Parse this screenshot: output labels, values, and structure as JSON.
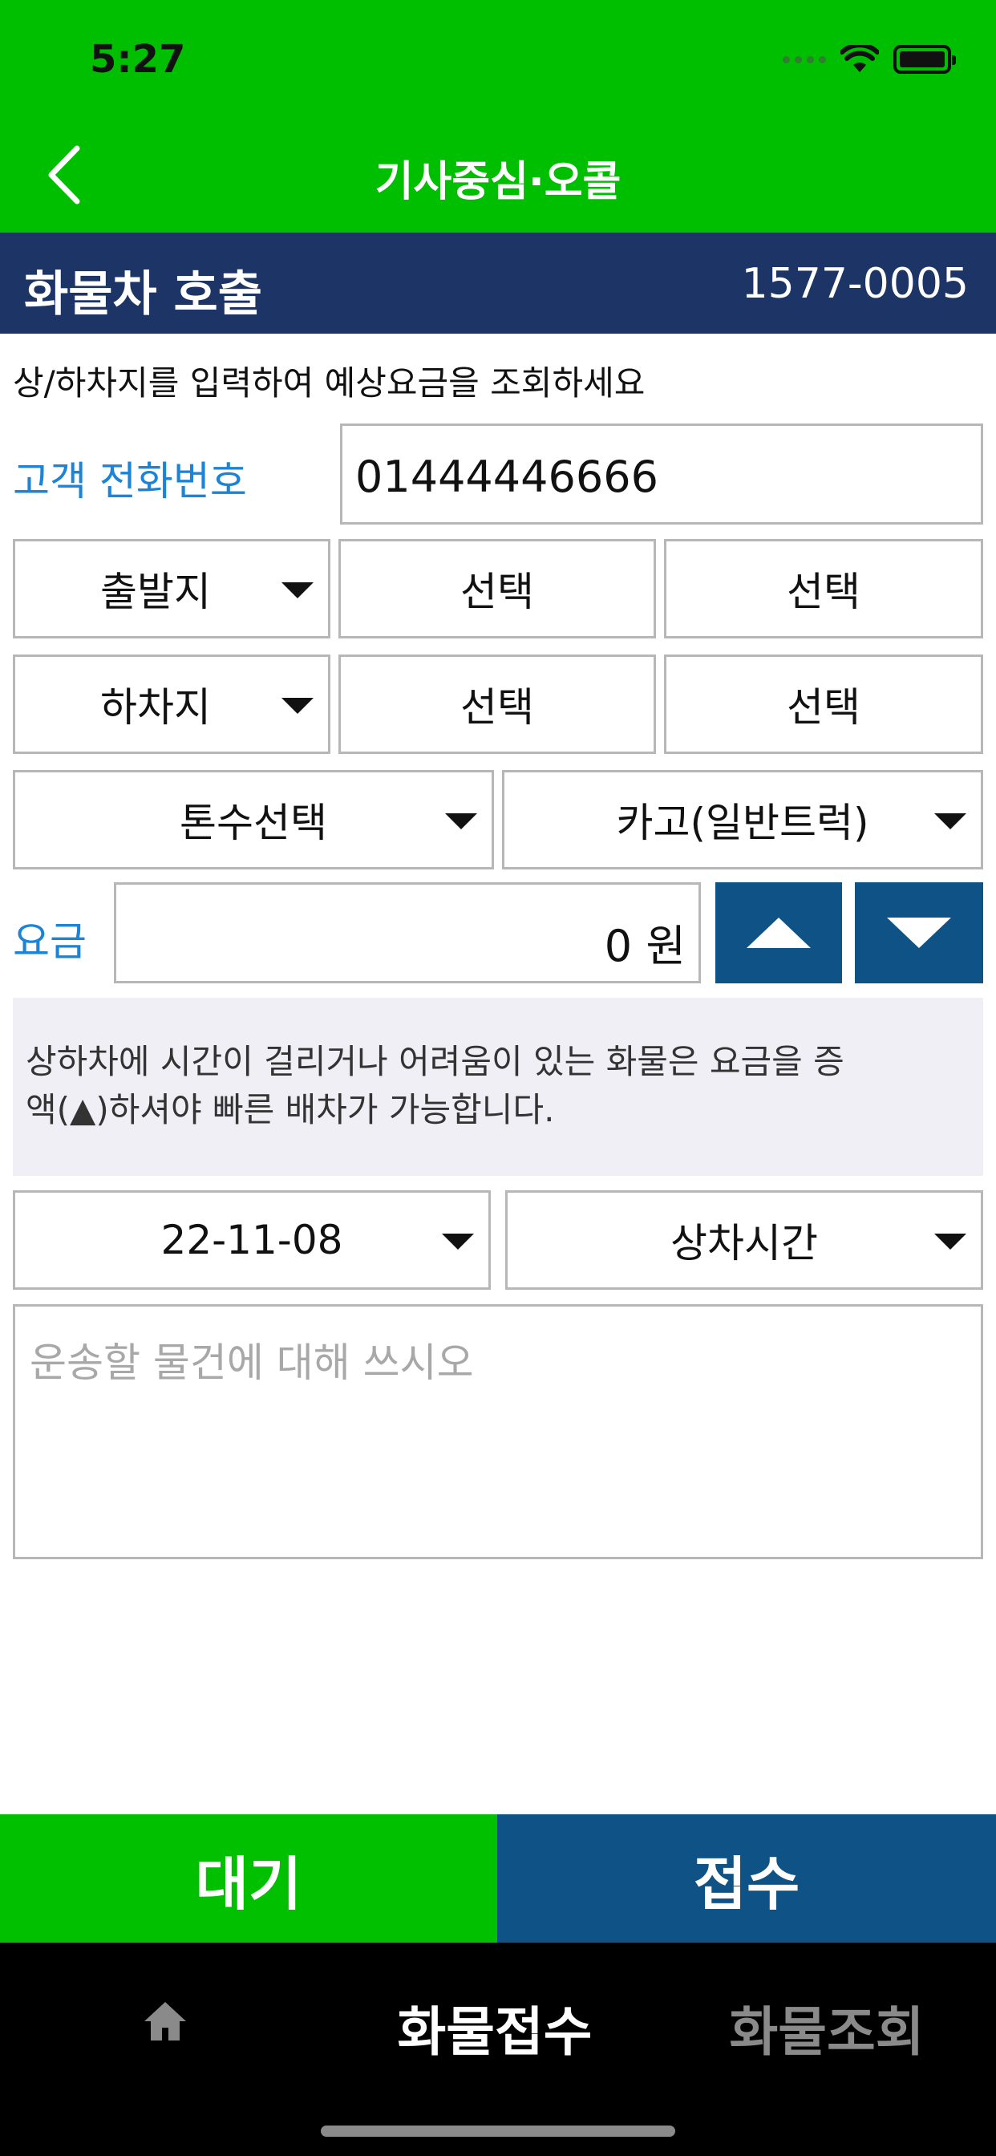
{
  "status_bar": {
    "time": "5:27"
  },
  "header": {
    "title": "기사중심·오콜"
  },
  "title_bar": {
    "title": "화물차 호출",
    "phone": "1577-0005"
  },
  "instruction": "상/하차지를 입력하여 예상요금을 조회하세요",
  "customer_phone": {
    "label": "고객 전화번호",
    "value": "01444446666"
  },
  "departure": {
    "type": "출발지",
    "select1": "선택",
    "select2": "선택"
  },
  "arrival": {
    "type": "하차지",
    "select1": "선택",
    "select2": "선택"
  },
  "tonnage": {
    "label": "톤수선택"
  },
  "vehicle_type": {
    "label": "카고(일반트럭)"
  },
  "fee": {
    "label": "요금",
    "value": "0",
    "unit": "원"
  },
  "notice": {
    "line1": "상하차에 시간이 걸리거나 어려움이 있는 화물은 요금을 증",
    "line2": "액(▲)하셔야 빠른 배차가 가능합니다."
  },
  "date": {
    "value": "22-11-08"
  },
  "loading_time": {
    "label": "상차시간"
  },
  "memo": {
    "placeholder": "운송할 물건에 대해 쓰시오"
  },
  "actions": {
    "wait": "대기",
    "submit": "접수"
  },
  "tabs": {
    "home_icon": "home-icon",
    "cargo": "화물접수",
    "lookup": "화물조회"
  },
  "colors": {
    "green": "#00bf00",
    "navy": "#1c3466",
    "blue": "#0f5285",
    "link_blue": "#1d83d6"
  }
}
